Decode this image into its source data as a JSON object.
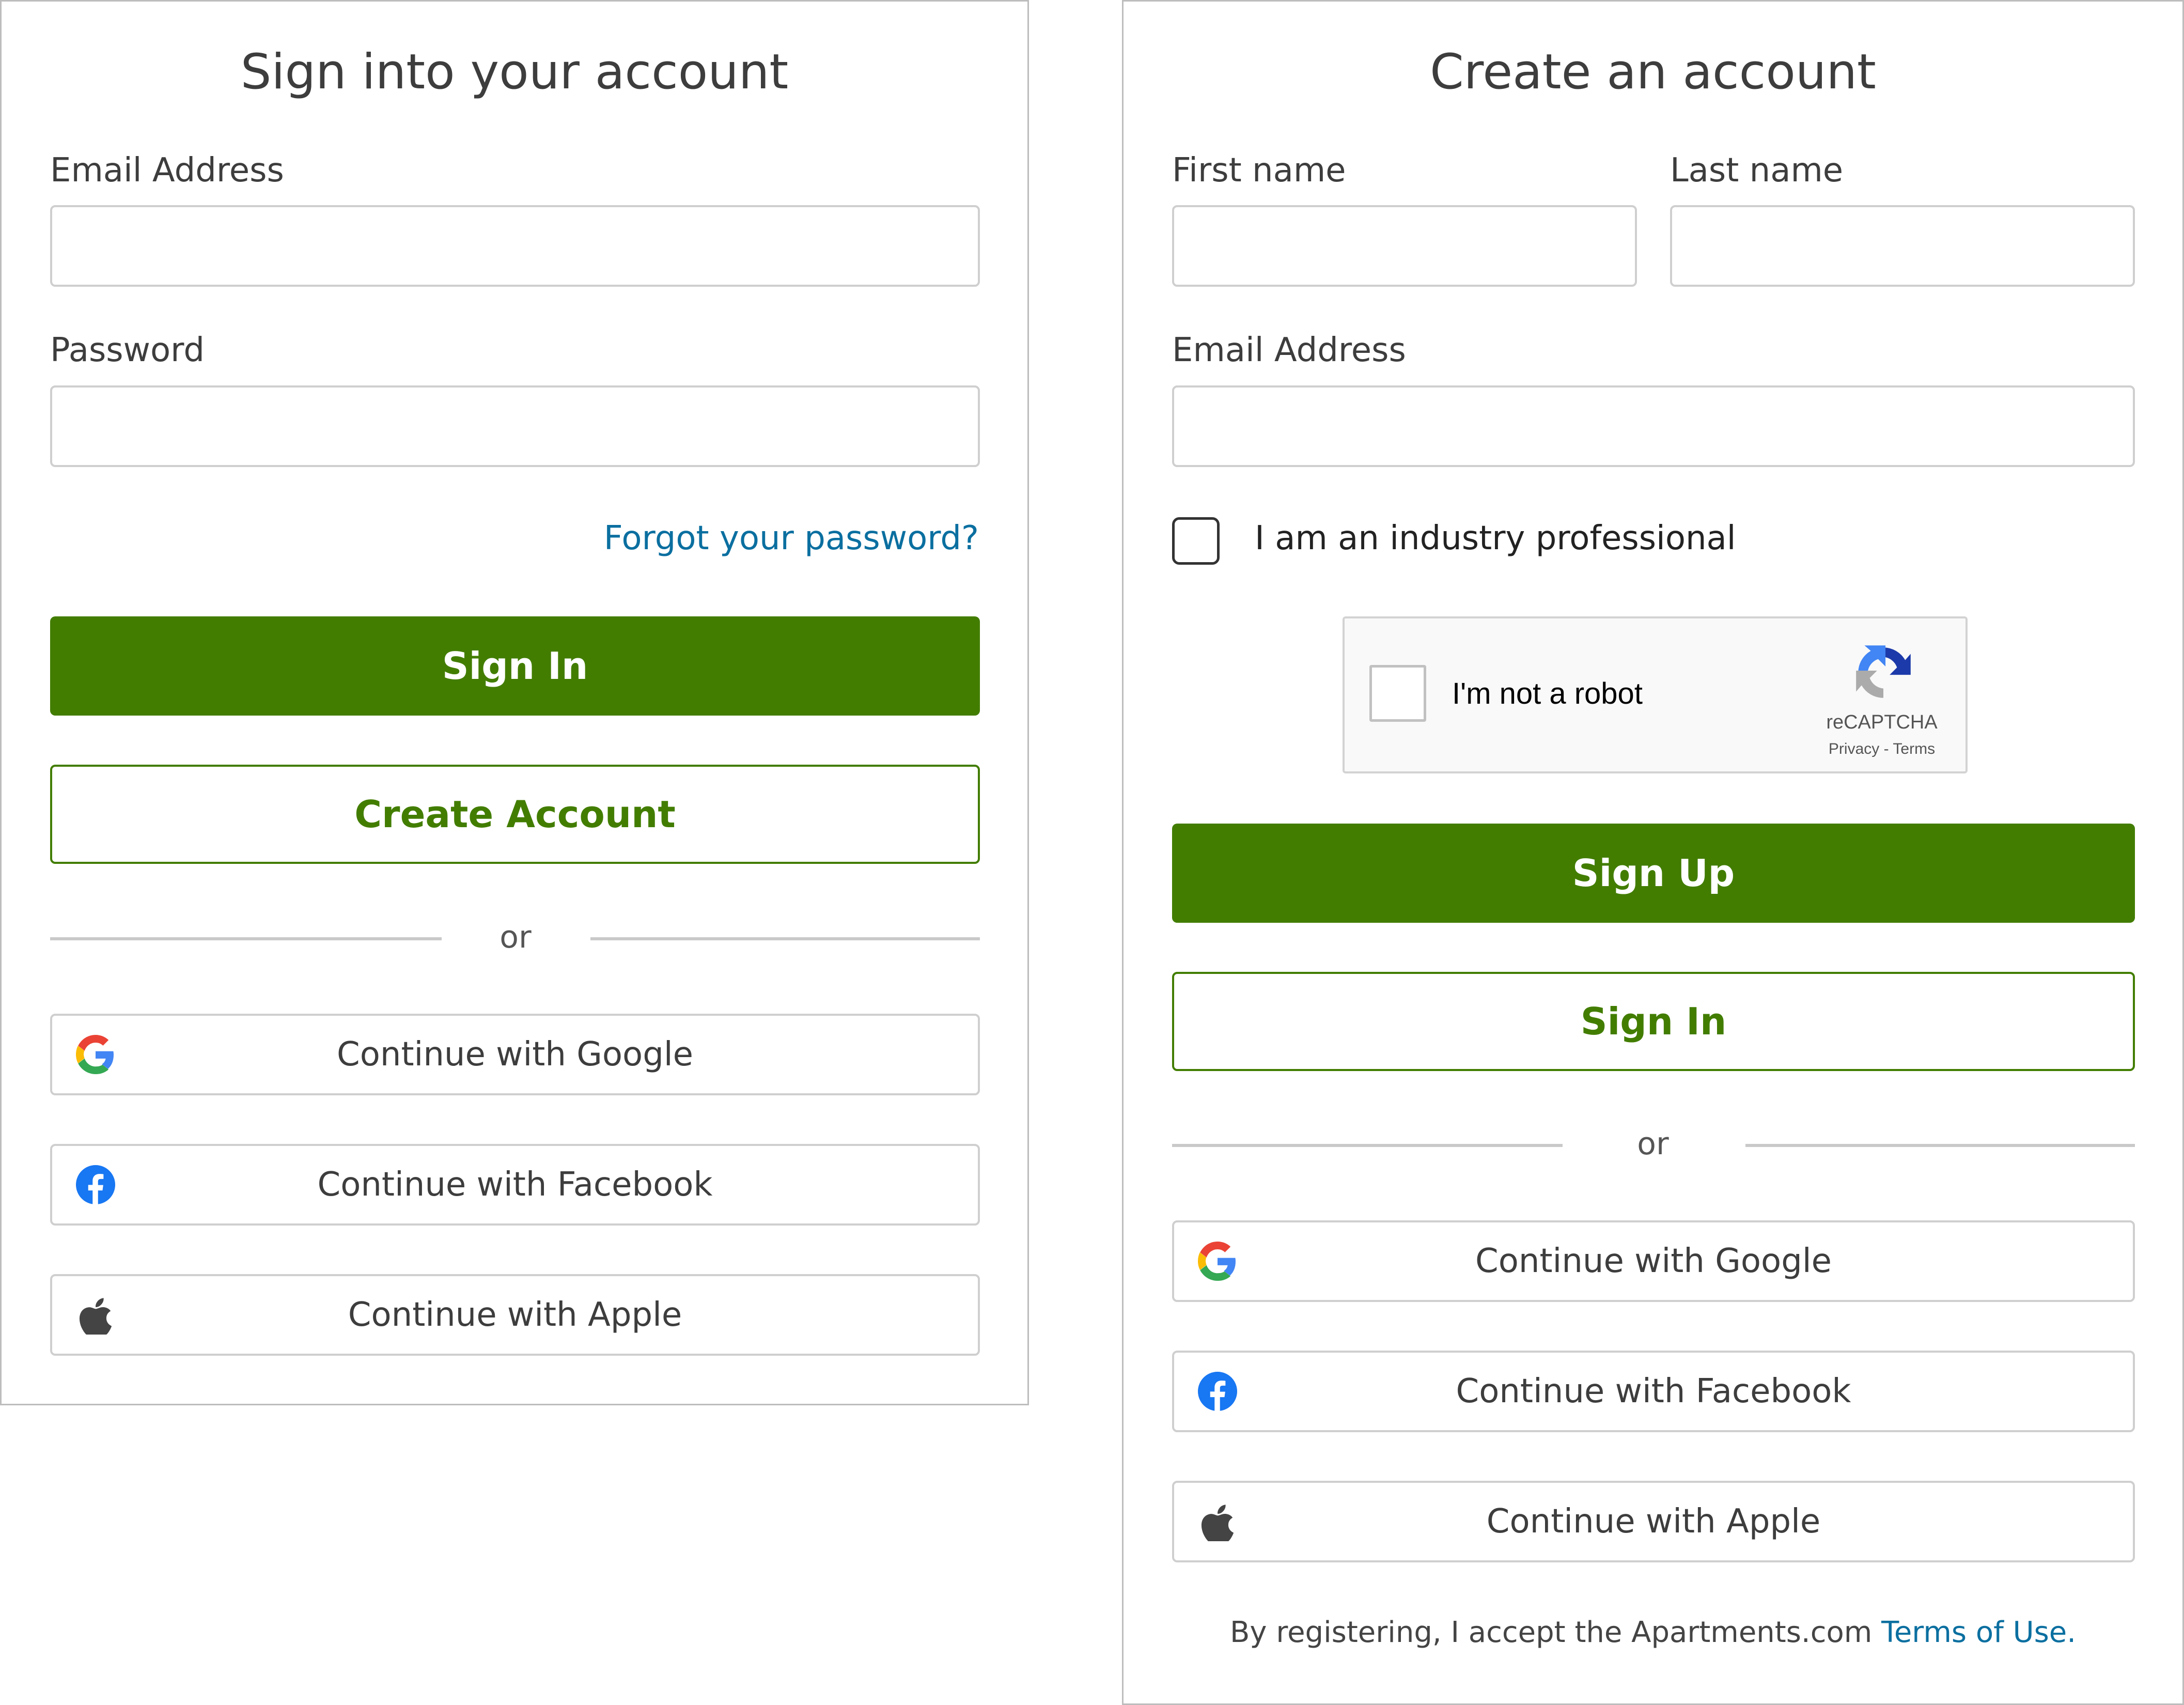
{
  "signin": {
    "title": "Sign into your account",
    "email_label": "Email Address",
    "email_value": "",
    "password_label": "Password",
    "password_value": "",
    "forgot_link": "Forgot your password?",
    "signin_button": "Sign In",
    "create_button": "Create Account",
    "divider_text": "or",
    "google_button": "Continue with Google",
    "facebook_button": "Continue with Facebook",
    "apple_button": "Continue with Apple"
  },
  "signup": {
    "title": "Create an account",
    "first_name_label": "First name",
    "first_name_value": "",
    "last_name_label": "Last name",
    "last_name_value": "",
    "email_label": "Email Address",
    "email_value": "",
    "industry_checkbox_label": "I am an industry professional",
    "industry_checked": false,
    "recaptcha": {
      "label": "I'm not a robot",
      "brand": "reCAPTCHA",
      "privacy": "Privacy",
      "separator": "-",
      "terms": "Terms"
    },
    "signup_button": "Sign Up",
    "signin_button": "Sign In",
    "divider_text": "or",
    "google_button": "Continue with Google",
    "facebook_button": "Continue with Facebook",
    "apple_button": "Continue with Apple",
    "footer_text": "By registering, I accept the Apartments.com ",
    "footer_link": "Terms of Use."
  },
  "colors": {
    "primary_green": "#427d00",
    "link_blue": "#0b6fa0",
    "border_gray": "#cfcfcf",
    "facebook_blue": "#1877f2"
  },
  "icons": [
    "google-icon",
    "facebook-icon",
    "apple-icon",
    "recaptcha-icon"
  ]
}
